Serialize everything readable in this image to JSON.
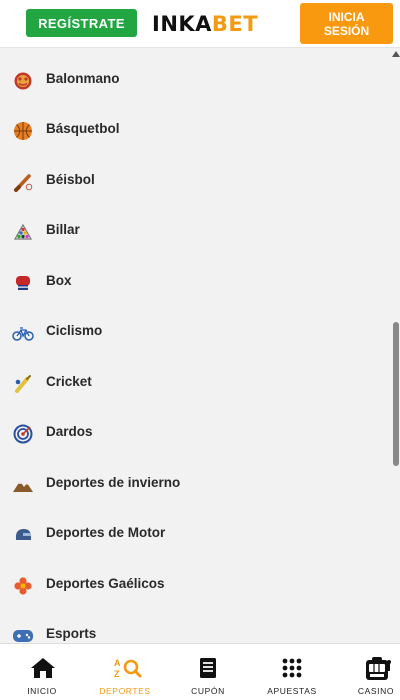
{
  "header": {
    "register_label": "REGÍSTRATE",
    "logo_part1": "INKA",
    "logo_part2": "BET",
    "login_label": "INICIA\nSESIÓN"
  },
  "sports": [
    {
      "label": "Balonmano",
      "icon": "handball-icon"
    },
    {
      "label": "Básquetbol",
      "icon": "basketball-icon"
    },
    {
      "label": "Béisbol",
      "icon": "baseball-icon"
    },
    {
      "label": "Billar",
      "icon": "billiards-icon"
    },
    {
      "label": "Box",
      "icon": "boxing-glove-icon"
    },
    {
      "label": "Ciclismo",
      "icon": "bicycle-icon"
    },
    {
      "label": "Cricket",
      "icon": "cricket-icon"
    },
    {
      "label": "Dardos",
      "icon": "dartboard-icon"
    },
    {
      "label": "Deportes de invierno",
      "icon": "mountain-icon"
    },
    {
      "label": "Deportes de Motor",
      "icon": "helmet-icon"
    },
    {
      "label": "Deportes Gaélicos",
      "icon": "gaelic-icon"
    },
    {
      "label": "Esports",
      "icon": "gamepad-icon"
    }
  ],
  "bottom_nav": [
    {
      "label": "INICIO",
      "icon": "home-icon"
    },
    {
      "label": "DEPORTES",
      "icon": "az-search-icon",
      "active": true
    },
    {
      "label": "CUPÓN",
      "icon": "coupon-icon"
    },
    {
      "label": "APUESTAS",
      "icon": "grid-icon"
    },
    {
      "label": "CASINO",
      "icon": "slot-machine-icon"
    }
  ],
  "colors": {
    "register_green": "#21a642",
    "brand_orange": "#f8990f",
    "background": "#f2f2f2"
  }
}
